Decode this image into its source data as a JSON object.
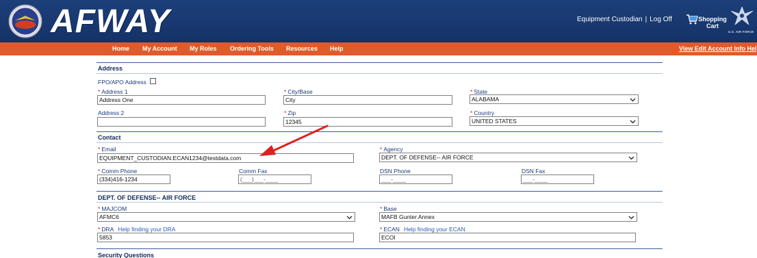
{
  "header": {
    "brand": "AFWAY",
    "user_role": "Equipment Custodian",
    "separator": "|",
    "logoff_label": "Log Off",
    "cart_label_line1": "Shopping",
    "cart_label_line2": "Cart",
    "af_caption": "U.S. AIR FORCE"
  },
  "nav": {
    "items": [
      "Home",
      "My Account",
      "My Roles",
      "Ordering Tools",
      "Resources",
      "Help"
    ],
    "right_link": "View Edit Account Info Help"
  },
  "address": {
    "section_title": "Address",
    "fpo_label": "FPO/APO Address",
    "fpo_checked": false,
    "address1_label": "Address 1",
    "address1_value": "Address One",
    "city_label": "City/Base",
    "city_value": "City",
    "state_label": "State",
    "state_value": "ALABAMA",
    "address2_label": "Address 2",
    "address2_value": "",
    "zip_label": "Zip",
    "zip_value": "12345",
    "country_label": "Country",
    "country_value": "UNITED STATES"
  },
  "contact": {
    "section_title": "Contact",
    "email_label": "Email",
    "email_value": "EQUIPMENT_CUSTODIAN.ECAN1234@testdata.com",
    "agency_label": "Agency",
    "agency_value": "DEPT. OF DEFENSE-- AIR FORCE",
    "comm_phone_label": "Comm Phone",
    "comm_phone_value": "(334)416-1234",
    "comm_fax_label": "Comm Fax",
    "comm_fax_placeholder": "(___)___-____",
    "dsn_phone_label": "DSN Phone",
    "dsn_phone_placeholder": "___-____",
    "dsn_fax_label": "DSN Fax",
    "dsn_fax_placeholder": "___-____"
  },
  "dod": {
    "section_title": "DEPT. OF DEFENSE-- AIR FORCE",
    "majcom_label": "MAJCOM",
    "majcom_value": "AFMC6",
    "base_label": "Base",
    "base_value": "MAFB Gunter Annex",
    "dra_label": "DRA",
    "dra_help": "Help finding your DRA",
    "dra_value": "5853",
    "ecan_label": "ECAN",
    "ecan_help": "Help finding your ECAN",
    "ecan_value": "ECOI"
  },
  "security": {
    "section_title": "Security Questions"
  },
  "required_marker": "*",
  "colors": {
    "header_bg": "#1c3f7a",
    "nav_bg": "#e15a2b",
    "required": "#d02020",
    "annotation_arrow": "#e02020"
  },
  "icons": {
    "seal": "afway-seal-icon",
    "cart": "shopping-cart-icon",
    "af_logo": "air-force-wings-icon",
    "dropdown": "chevron-down-icon"
  }
}
